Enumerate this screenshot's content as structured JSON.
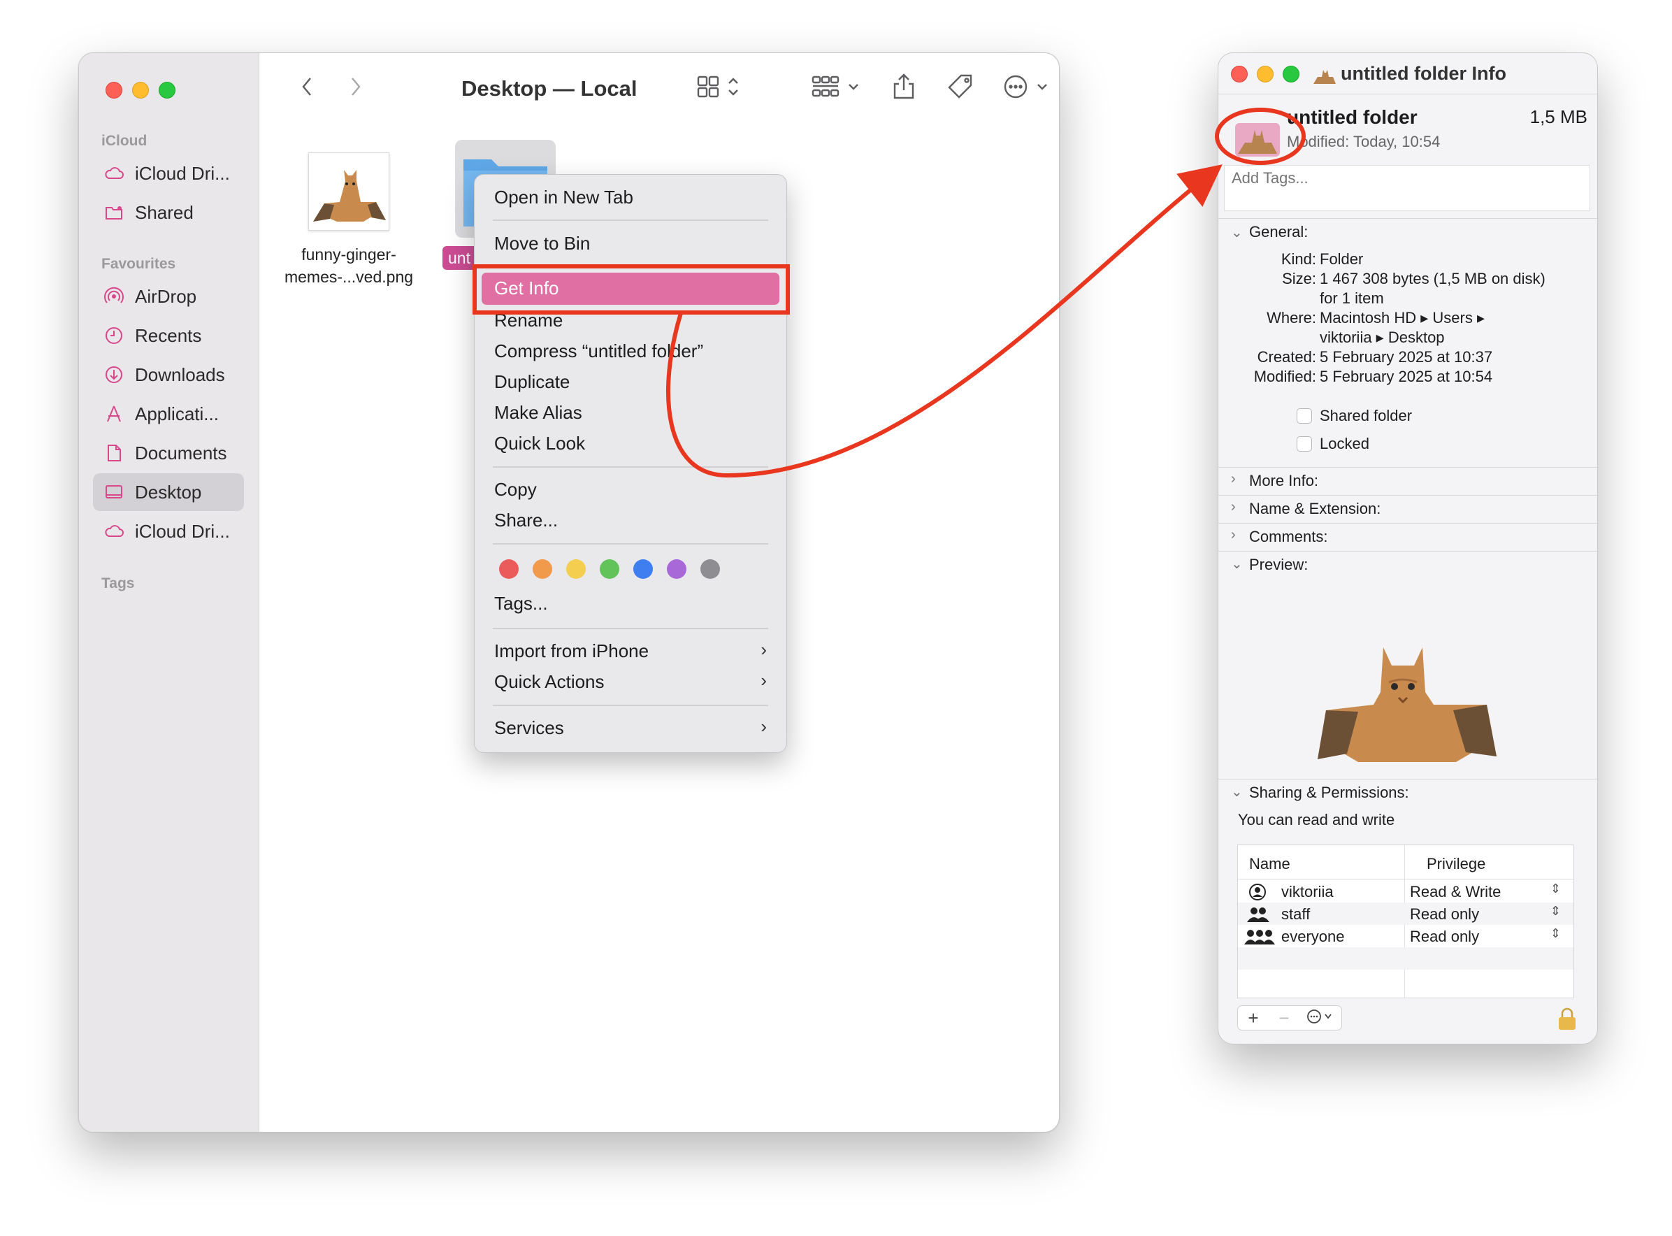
{
  "finder": {
    "title": "Desktop — Local",
    "sidebar": {
      "sections": [
        "iCloud",
        "Favourites",
        "Tags"
      ],
      "items": [
        {
          "label": "iCloud Dri...",
          "icon": "cloud-icon"
        },
        {
          "label": "Shared",
          "icon": "shared-folder-icon"
        },
        {
          "label": "AirDrop",
          "icon": "airdrop-icon"
        },
        {
          "label": "Recents",
          "icon": "clock-icon"
        },
        {
          "label": "Downloads",
          "icon": "download-icon"
        },
        {
          "label": "Applicati...",
          "icon": "applications-icon"
        },
        {
          "label": "Documents",
          "icon": "document-icon"
        },
        {
          "label": "Desktop",
          "icon": "desktop-icon",
          "selected": true
        },
        {
          "label": "iCloud Dri...",
          "icon": "cloud-icon"
        }
      ]
    },
    "files": [
      {
        "name_line1": "funny-ginger-",
        "name_line2": "memes-...ved.png"
      },
      {
        "name": "unt"
      }
    ]
  },
  "context_menu": {
    "items": {
      "open_new_tab": "Open in New Tab",
      "move_to_bin": "Move to Bin",
      "get_info": "Get Info",
      "rename": "Rename",
      "compress": "Compress “untitled folder”",
      "duplicate": "Duplicate",
      "make_alias": "Make Alias",
      "quick_look": "Quick Look",
      "copy": "Copy",
      "share": "Share...",
      "tags": "Tags...",
      "import_iphone": "Import from iPhone",
      "quick_actions": "Quick Actions",
      "services": "Services"
    },
    "tag_colors": [
      "#ec5b5b",
      "#f19a4b",
      "#f4cf4f",
      "#63c35b",
      "#3f7ef0",
      "#a868d8",
      "#8e8e92"
    ],
    "highlight_color": "#e06fa3"
  },
  "info_window": {
    "title": "untitled folder Info",
    "name": "untitled folder",
    "size_short": "1,5 MB",
    "modified_short": "Modified: Today, 10:54",
    "tags_placeholder": "Add Tags...",
    "general_header": "General:",
    "general": {
      "kind_label": "Kind:",
      "kind": "Folder",
      "size_label": "Size:",
      "size": "1 467 308 bytes (1,5 MB on disk)",
      "size_items": "for 1 item",
      "where_label": "Where:",
      "where_line1": "Macintosh HD ▸ Users ▸",
      "where_line2": "viktoriia ▸ Desktop",
      "created_label": "Created:",
      "created": "5 February 2025 at 10:37",
      "modified_label": "Modified:",
      "modified": "5 February 2025 at 10:54",
      "shared_folder": "Shared folder",
      "locked": "Locked"
    },
    "sections": {
      "more_info": "More Info:",
      "name_ext": "Name & Extension:",
      "comments": "Comments:",
      "preview": "Preview:",
      "sharing": "Sharing & Permissions:"
    },
    "sharing_note": "You can read and write",
    "permissions": {
      "col_name": "Name",
      "col_privilege": "Privilege",
      "rows": [
        {
          "name": "viktoriia",
          "privilege": "Read & Write",
          "icon": "user-icon"
        },
        {
          "name": "staff",
          "privilege": "Read only",
          "icon": "group-icon"
        },
        {
          "name": "everyone",
          "privilege": "Read only",
          "icon": "everyone-icon"
        }
      ]
    }
  },
  "annotation_color": "#e8361f"
}
